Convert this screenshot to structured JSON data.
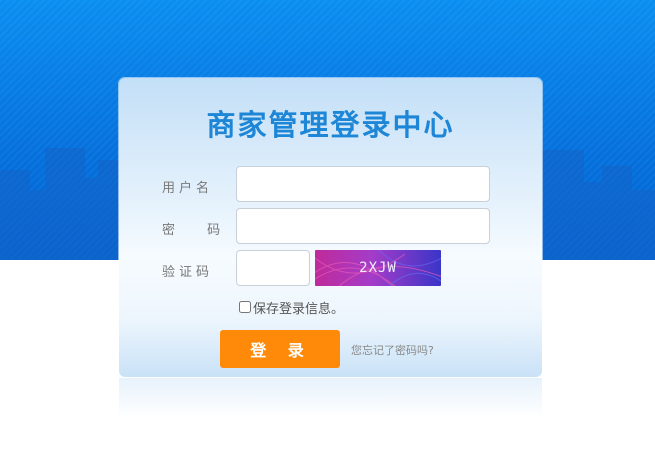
{
  "colors": {
    "background_blue": "#0572dd",
    "title": "#1d86d6",
    "button": "#ff8a0a",
    "card_top": "#c3dff7"
  },
  "login": {
    "title": "商家管理登录中心",
    "username_label": "用户名",
    "password_label": "密 码",
    "captcha_label": "验证码",
    "username_value": "",
    "password_value": "",
    "captcha_value": "",
    "captcha_text": "2XJW",
    "remember_label": "保存登录信息。",
    "remember_checked": false,
    "login_button": "登 录",
    "forgot_link": "您忘记了密码吗?"
  }
}
